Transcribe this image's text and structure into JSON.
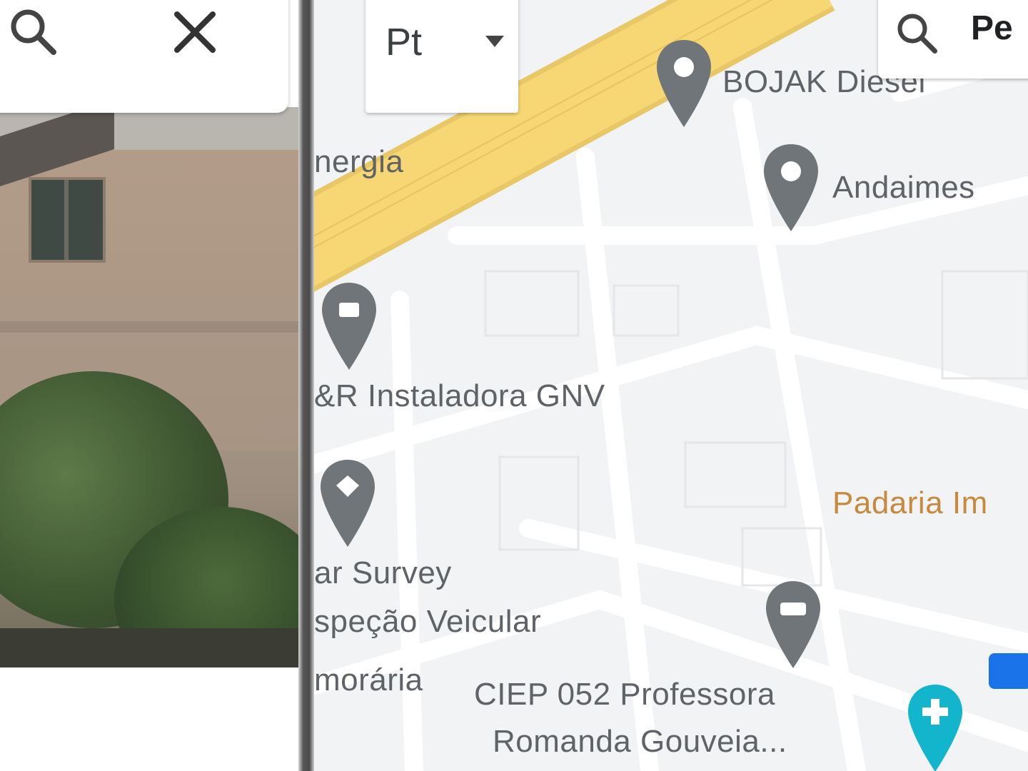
{
  "left_panel": {
    "search_icon": "search-icon",
    "close_icon": "close-icon"
  },
  "map": {
    "layer_dropdown": {
      "selected": "Pt",
      "arrow_icon": "dropdown-arrow-icon"
    },
    "search": {
      "icon": "search-icon",
      "text": "Pe"
    },
    "pois": [
      {
        "label": "BOJAK Diesel"
      },
      {
        "label": "Andaimes"
      },
      {
        "label": "nergia"
      },
      {
        "label": "&R Instaladora GNV"
      },
      {
        "label": "Padaria Im"
      },
      {
        "label": "ar Survey"
      },
      {
        "label": "speção Veicular"
      },
      {
        "label": "morária"
      },
      {
        "label": "CIEP 052 Professora"
      },
      {
        "label": "Romanda Gouveia..."
      }
    ]
  },
  "colors": {
    "map_background": "#f1f3f4",
    "highway": "#f6d774",
    "poi_text": "#5f6368",
    "pin_gray": "#70757a",
    "pin_teal": "#12b5cb",
    "bakery_text": "#c78a3c"
  }
}
